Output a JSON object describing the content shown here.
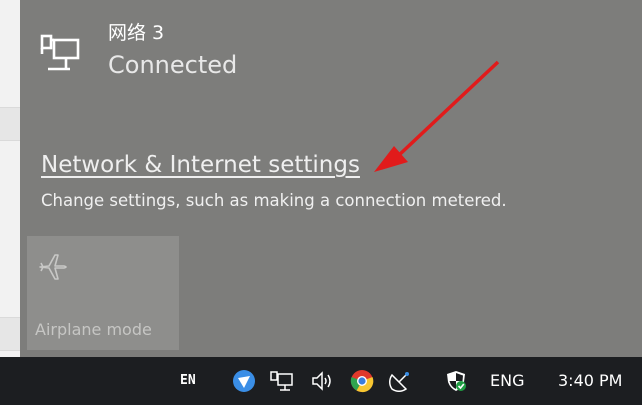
{
  "network": {
    "name": "网络 3",
    "status": "Connected",
    "icon": "wired-network-icon"
  },
  "settings": {
    "link_text": "Network & Internet settings",
    "description": "Change settings, such as making a connection metered."
  },
  "quick_actions": {
    "airplane_mode": {
      "label": "Airplane mode",
      "icon": "airplane-icon",
      "state": "off"
    }
  },
  "annotation": {
    "color": "#e11b1b"
  },
  "taskbar": {
    "ime_indicator": "EN",
    "language": "ENG",
    "clock": "3:40 PM",
    "tray_icons": [
      "shield-app-icon",
      "network-icon",
      "volume-icon",
      "chrome-icon",
      "satellite-icon",
      "security-icon"
    ]
  },
  "colors": {
    "flyout_bg": "#7d7d7b",
    "tile_bg": "#8e8e8c",
    "taskbar_bg": "#1c1e21"
  }
}
